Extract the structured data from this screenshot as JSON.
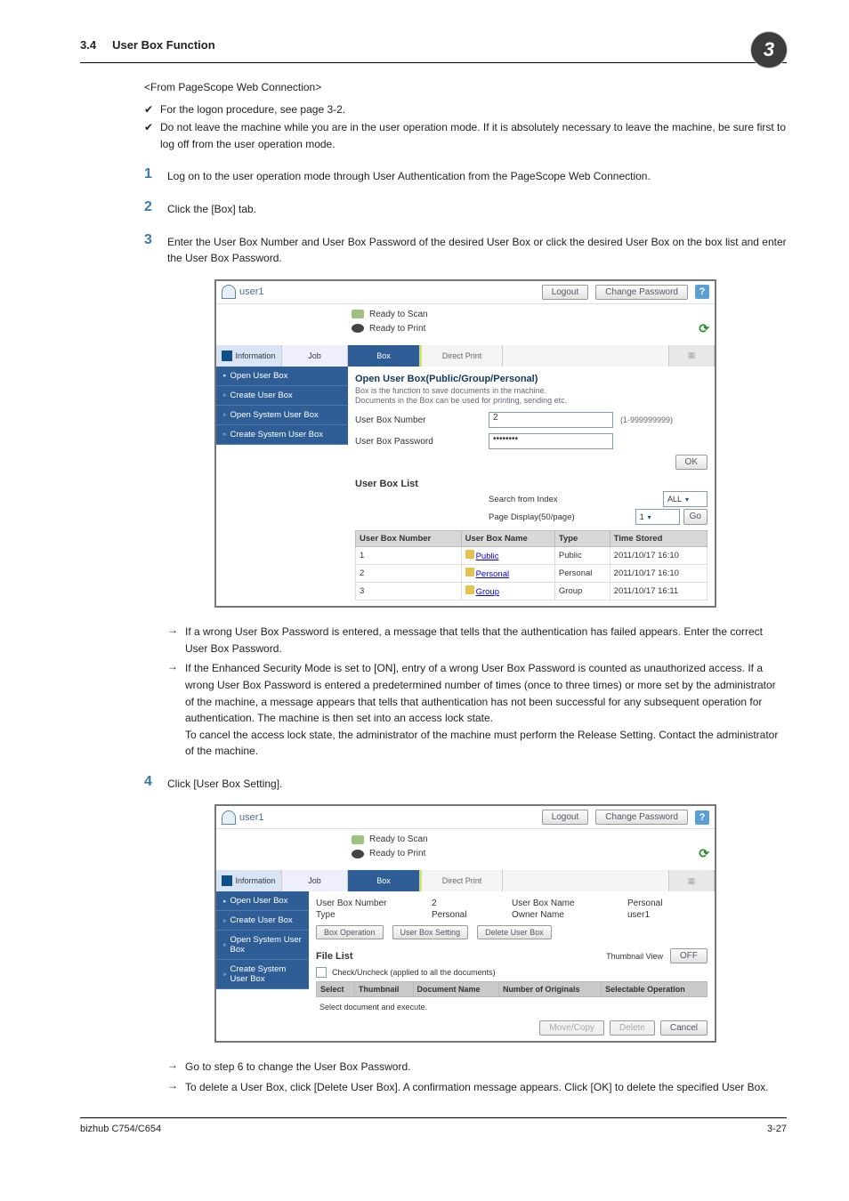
{
  "header": {
    "section_num": "3.4",
    "section_title": "User Box Function",
    "chapter_badge": "3"
  },
  "intro": {
    "from": "<From PageScope Web Connection>",
    "b1": "For the logon procedure, see page 3-2.",
    "b2": "Do not leave the machine while you are in the user operation mode. If it is absolutely necessary to leave the machine, be sure first to log off from the user operation mode."
  },
  "steps": {
    "s1": "Log on to the user operation mode through User Authentication from the PageScope Web Connection.",
    "s2": "Click the [Box] tab.",
    "s3": "Enter the User Box Number and User Box Password of the desired User Box or click the desired User Box on the box list and enter the User Box Password.",
    "s3a1": "If a wrong User Box Password is entered, a message that tells that the authentication has failed appears. Enter the correct User Box Password.",
    "s3a2": "If the Enhanced Security Mode is set to [ON], entry of a wrong User Box Password is counted as unauthorized access. If a wrong User Box Password is entered a predetermined number of times (once to three times) or more set by the administrator of the machine, a message appears that tells that authentication has not been successful for any subsequent operation for authentication. The machine is then set into an access lock state.",
    "s3a2b": "To cancel the access lock state, the administrator of the machine must perform the Release Setting. Contact the administrator of the machine.",
    "s4": "Click [User Box Setting].",
    "s4a1": "Go to step 6 to change the User Box Password.",
    "s4a2": "To delete a User Box, click [Delete User Box]. A confirmation message appears. Click [OK] to delete the specified User Box."
  },
  "shot1": {
    "user": "user1",
    "logout": "Logout",
    "change_pw": "Change Password",
    "ready_scan": "Ready to Scan",
    "ready_print": "Ready to Print",
    "tab_info": "Information",
    "tab_job": "Job",
    "tab_box": "Box",
    "tab_direct": "Direct Print",
    "side1": "Open User Box",
    "side2": "Create User Box",
    "side3": "Open System User Box",
    "side4": "Create System User Box",
    "h1": "Open User Box(Public/Group/Personal)",
    "h1a": "Box is the function to save documents in the machine.",
    "h1b": "Documents in the Box can be used for printing, sending etc.",
    "lbl_num": "User Box Number",
    "lbl_pw": "User Box Password",
    "num_val": "2",
    "num_hint": "(1-999999999)",
    "pw_val": "••••••••",
    "ok": "OK",
    "list_title": "User Box List",
    "sfi": "Search from Index",
    "pdisp": "Page Display(50/page)",
    "all": "ALL",
    "one": "1",
    "go": "Go",
    "th_num": "User Box Number",
    "th_name": "User Box Name",
    "th_type": "Type",
    "th_time": "Time Stored",
    "rows": [
      {
        "n": "1",
        "name": "Public",
        "type": "Public",
        "time": "2011/10/17 16:10"
      },
      {
        "n": "2",
        "name": "Personal",
        "type": "Personal",
        "time": "2011/10/17 16:10"
      },
      {
        "n": "3",
        "name": "Group",
        "type": "Group",
        "time": "2011/10/17 16:11"
      }
    ]
  },
  "shot2": {
    "ubnum_l": "User Box Number",
    "ubnum_v": "2",
    "ubname_l": "User Box Name",
    "ubname_v": "Personal",
    "type_l": "Type",
    "type_v": "Personal",
    "owner_l": "Owner Name",
    "owner_v": "user1",
    "btn_boxop": "Box Operation",
    "btn_ubs": "User Box Setting",
    "btn_del": "Delete User Box",
    "file_list": "File List",
    "thumb_l": "Thumbnail View",
    "off": "OFF",
    "chk": "Check/Uncheck (applied to all the documents)",
    "th1": "Select",
    "th2": "Thumbnail",
    "th3": "Document Name",
    "th4": "Number of Originals",
    "th5": "Selectable Operation",
    "exec": "Select document and execute.",
    "move": "Move/Copy",
    "delete": "Delete",
    "cancel": "Cancel"
  },
  "footer": {
    "left": "bizhub C754/C654",
    "right": "3-27"
  }
}
